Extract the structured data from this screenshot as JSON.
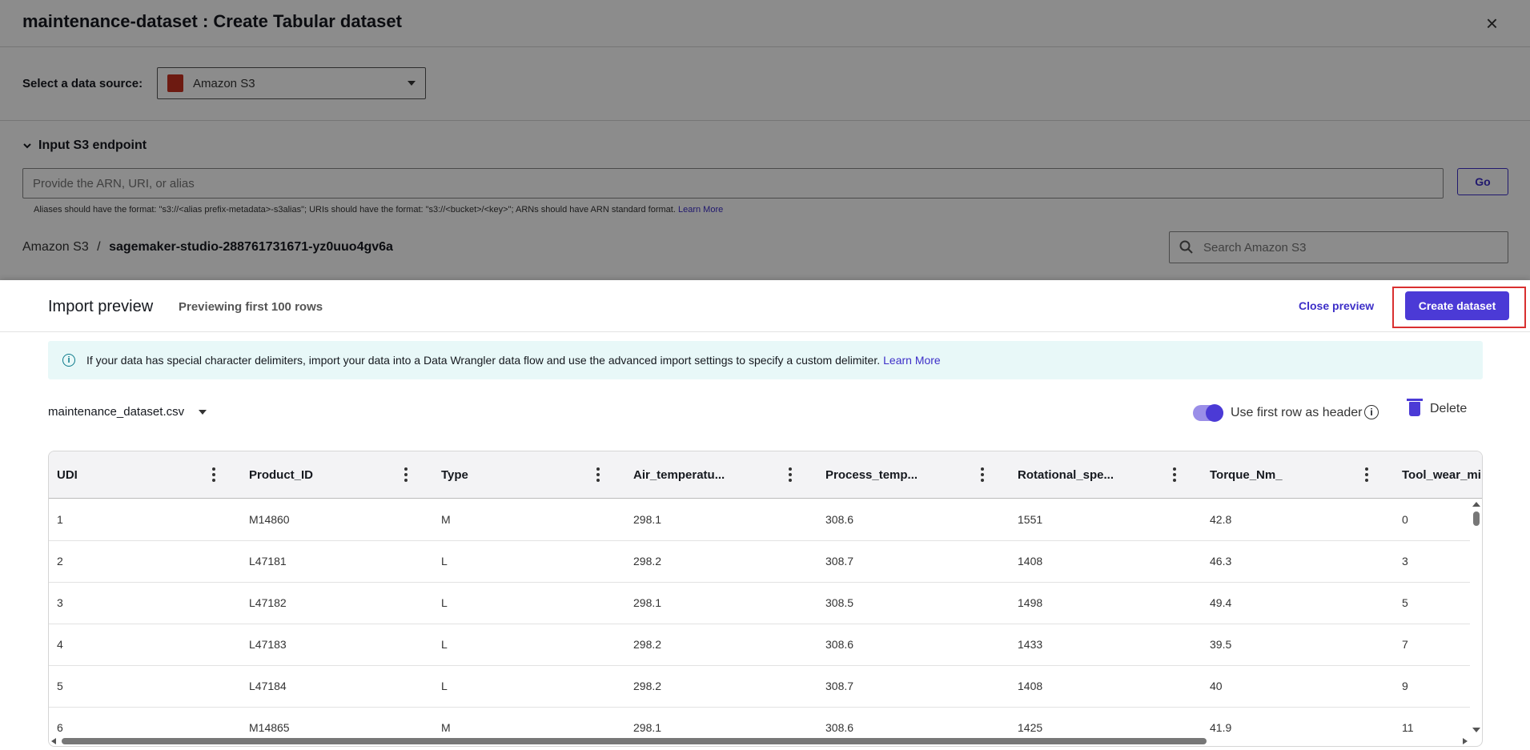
{
  "header": {
    "title": "maintenance-dataset : Create Tabular dataset",
    "close_icon": "×"
  },
  "source": {
    "label": "Select a data source:",
    "selected": "Amazon S3",
    "icon": "amazon-s3-icon"
  },
  "endpoint": {
    "section_label": "Input S3 endpoint",
    "placeholder": "Provide the ARN, URI, or alias",
    "go_label": "Go",
    "help_text": "Aliases should have the format: \"s3://<alias prefix-metadata>-s3alias\"; URIs should have the format: \"s3://<bucket>/<key>\"; ARNs should have ARN standard format.",
    "help_link": "Learn More"
  },
  "breadcrumb": {
    "root": "Amazon S3",
    "separator": "/",
    "bucket": "sagemaker-studio-288761731671-yz0uuo4gv6a"
  },
  "search": {
    "placeholder": "Search Amazon S3"
  },
  "preview": {
    "title": "Import preview",
    "subtitle": "Previewing first 100 rows",
    "close_label": "Close preview",
    "create_label": "Create dataset",
    "info_text": "If your data has special character delimiters, import your data into a Data Wrangler data flow and use the advanced import settings to specify a custom delimiter.",
    "info_link": "Learn More",
    "file_name": "maintenance_dataset.csv",
    "header_toggle_label": "Use first row as header",
    "header_toggle_on": true,
    "delete_label": "Delete"
  },
  "table": {
    "columns": [
      "UDI",
      "Product_ID",
      "Type",
      "Air_temperatu...",
      "Process_temp...",
      "Rotational_spe...",
      "Torque_Nm_",
      "Tool_wear_mi"
    ],
    "rows": [
      [
        "1",
        "M14860",
        "M",
        "298.1",
        "308.6",
        "1551",
        "42.8",
        "0"
      ],
      [
        "2",
        "L47181",
        "L",
        "298.2",
        "308.7",
        "1408",
        "46.3",
        "3"
      ],
      [
        "3",
        "L47182",
        "L",
        "298.1",
        "308.5",
        "1498",
        "49.4",
        "5"
      ],
      [
        "4",
        "L47183",
        "L",
        "298.2",
        "308.6",
        "1433",
        "39.5",
        "7"
      ],
      [
        "5",
        "L47184",
        "L",
        "298.2",
        "308.7",
        "1408",
        "40",
        "9"
      ],
      [
        "6",
        "M14865",
        "M",
        "298.1",
        "308.6",
        "1425",
        "41.9",
        "11"
      ]
    ]
  },
  "colors": {
    "accent": "#4b3ad6",
    "link": "#3d2fc8",
    "highlight_border": "#d93030",
    "info_bg": "#e8f8f8"
  }
}
